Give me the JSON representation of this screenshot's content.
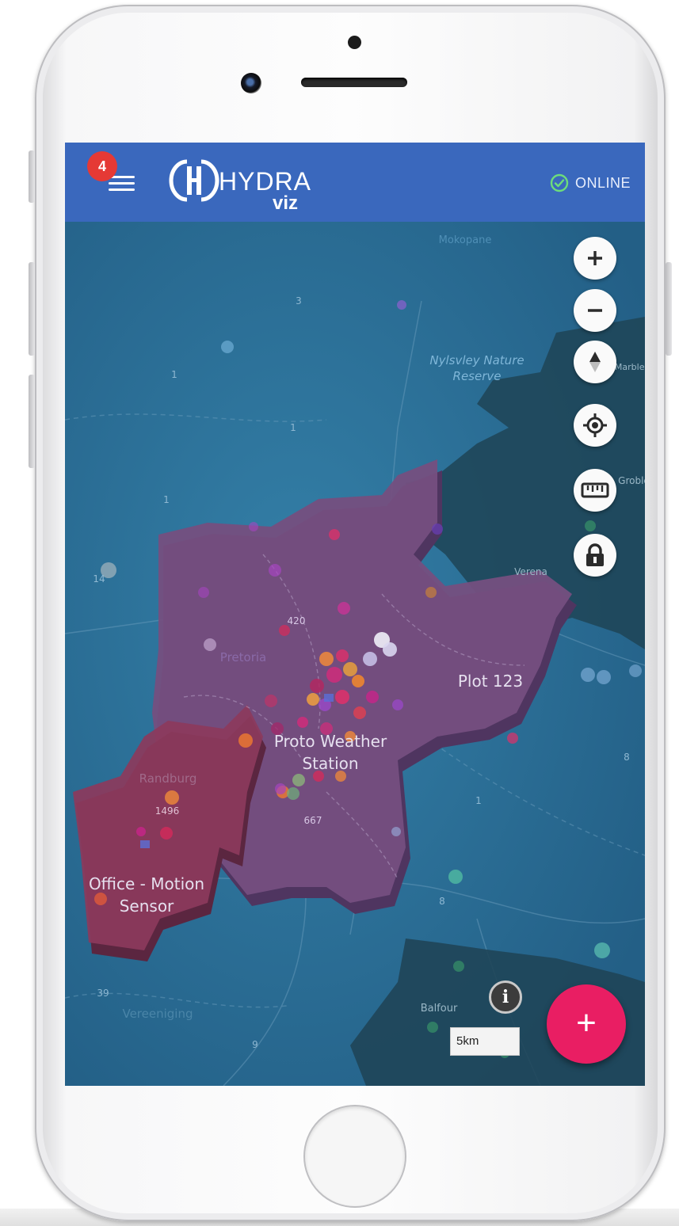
{
  "app": {
    "brand": "HYDRA",
    "brand_sub": "viz",
    "notification_count": "4",
    "status_label": "ONLINE"
  },
  "map": {
    "labels": {
      "nature_reserve": "Nylsvley Nature\nReserve",
      "mokopane": "Mokopane",
      "vereniging": "Vereeniging",
      "randburg": "Randburg",
      "pretoria": "Pretoria",
      "balfour": "Balfour",
      "verena": "Verena",
      "groblersdal": "Groble",
      "marble_hall": "Marble Hall"
    },
    "road_numbers": [
      "3",
      "1",
      "1",
      "1",
      "14",
      "420",
      "1496",
      "667",
      "1",
      "8",
      "8",
      "39",
      "9"
    ],
    "places": [
      {
        "name": "Plot 123"
      },
      {
        "name": "Proto Weather\nStation"
      },
      {
        "name": "Office - Motion\nSensor"
      }
    ],
    "scale": "5km",
    "controls": [
      "zoom-in",
      "zoom-out",
      "compass",
      "locate",
      "measure",
      "lock"
    ]
  },
  "fab": {
    "label": "+"
  },
  "colors": {
    "appbar": "#3a68bd",
    "map_water": "#2a6f96",
    "region_purple": "#754f80",
    "region_red": "#8c3a5c",
    "region_dark": "#1f4558",
    "fab": "#e91e63",
    "badge": "#e53935",
    "online": "#6ddc7b"
  }
}
